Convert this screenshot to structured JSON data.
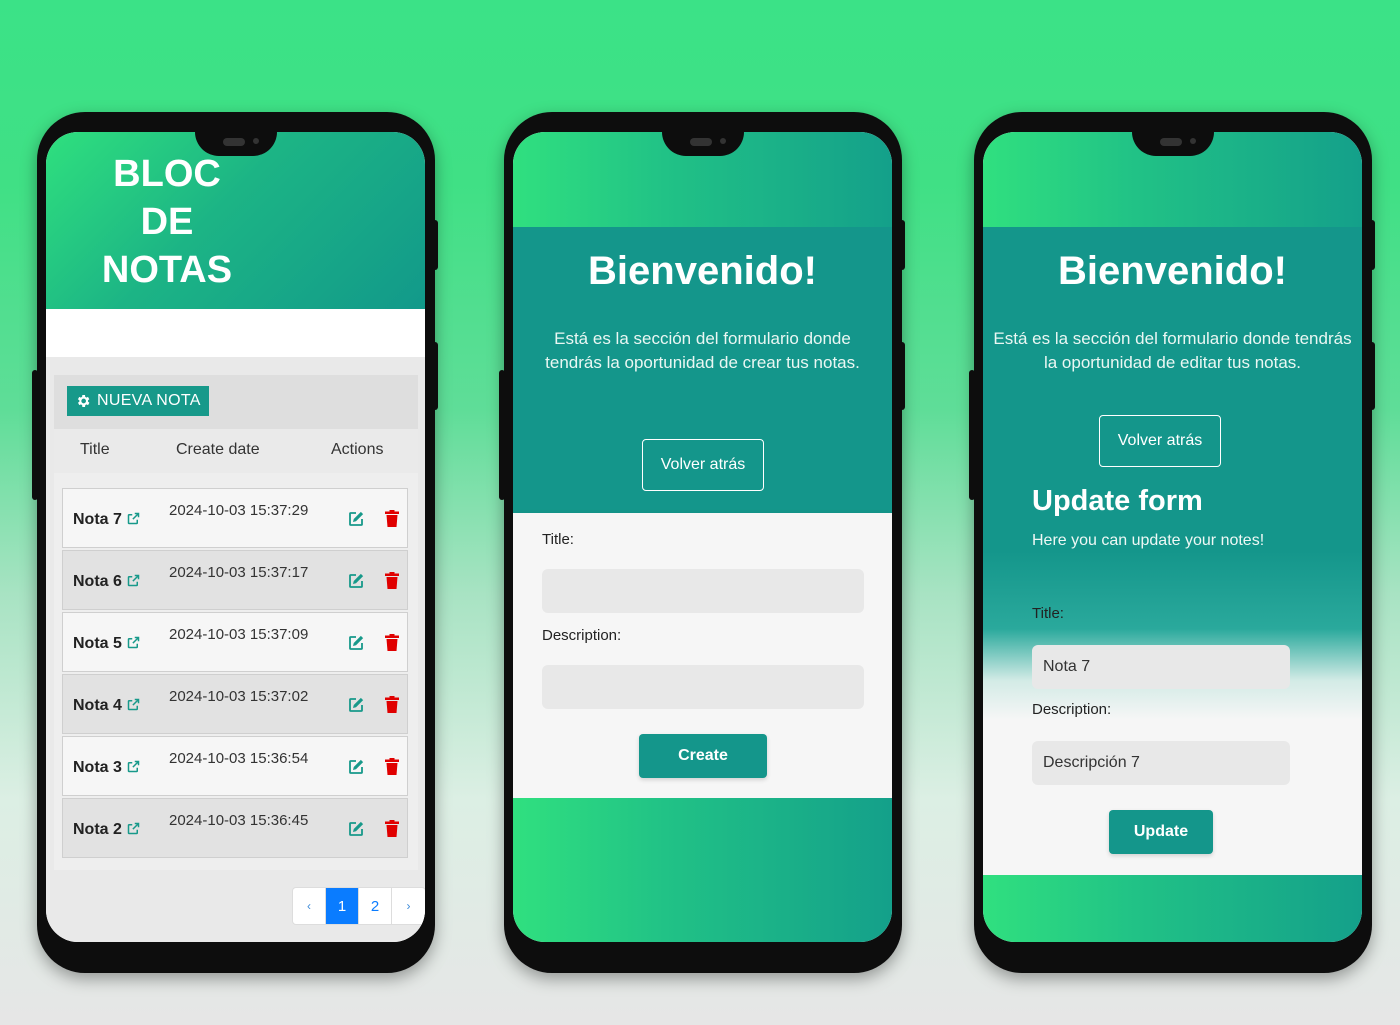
{
  "phone1": {
    "app_title": "BLOC DE NOTAS",
    "new_note_label": "NUEVA NOTA",
    "columns": [
      "Title",
      "Create date",
      "Actions"
    ],
    "rows": [
      {
        "title": "Nota 7",
        "date": "2024-10-03 15:37:29"
      },
      {
        "title": "Nota 6",
        "date": "2024-10-03 15:37:17"
      },
      {
        "title": "Nota 5",
        "date": "2024-10-03 15:37:09"
      },
      {
        "title": "Nota 4",
        "date": "2024-10-03 15:37:02"
      },
      {
        "title": "Nota 3",
        "date": "2024-10-03 15:36:54"
      },
      {
        "title": "Nota 2",
        "date": "2024-10-03 15:36:45"
      }
    ],
    "pagination": {
      "prev": "‹",
      "pages": [
        "1",
        "2"
      ],
      "current": "1",
      "next": "›"
    }
  },
  "phone2": {
    "heading": "Bienvenido!",
    "description": "Está es la sección del formulario donde tendrás la oportunidad de crear tus notas.",
    "back_label": "Volver atrás",
    "title_label": "Title:",
    "title_value": "",
    "description_label": "Description:",
    "description_value": "",
    "submit_label": "Create"
  },
  "phone3": {
    "heading": "Bienvenido!",
    "description": "Está es la sección del formulario donde tendrás la oportunidad de editar tus notas.",
    "back_label": "Volver atrás",
    "form_heading": "Update form",
    "form_subheading": "Here you can update your notes!",
    "title_label": "Title:",
    "title_value": "Nota 7",
    "description_label": "Description:",
    "description_value": "Descripción 7",
    "submit_label": "Update"
  },
  "colors": {
    "teal": "#14968b",
    "green": "#30e07f",
    "blue_page": "#0a7cff",
    "delete_red": "#e00000"
  },
  "icons": [
    "gear-icon",
    "external-link-icon",
    "edit-icon",
    "trash-icon"
  ]
}
